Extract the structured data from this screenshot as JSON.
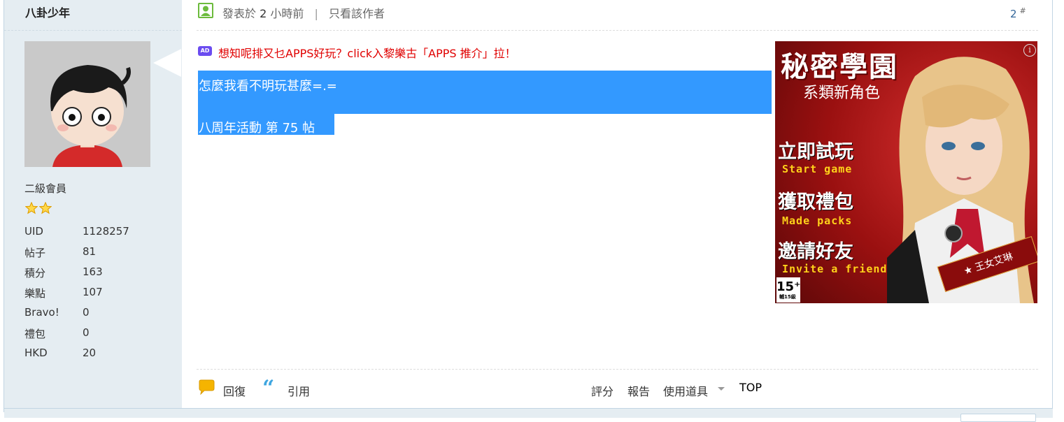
{
  "author": {
    "username": "八卦少年",
    "rank": "二級會員",
    "stars": 2,
    "stats": [
      {
        "key": "UID",
        "value": "1128257"
      },
      {
        "key": "帖子",
        "value": "81"
      },
      {
        "key": "積分",
        "value": "163"
      },
      {
        "key": "樂點",
        "value": "107"
      },
      {
        "key": "Bravo!",
        "value": "0"
      },
      {
        "key": "禮包",
        "value": "0"
      },
      {
        "key": "HKD",
        "value": "20"
      }
    ]
  },
  "post_header": {
    "posted_prefix": "發表於",
    "posted_num": "2",
    "posted_suffix": "小時前",
    "separator": "|",
    "author_only": "只看該作者",
    "floor_number": "2",
    "floor_mark": "#"
  },
  "ad_line": {
    "icon": "AD",
    "text": "想知呢排又乜APPS好玩？click入黎樂古「APPS 推介」拉！"
  },
  "content": {
    "line1": "怎麼我看不明玩甚麼=.=",
    "line2": "八周年活動 第 75 帖"
  },
  "banner": {
    "title": "秘密學園",
    "subtitle": "系類新角色",
    "ctas": [
      {
        "zh": "立即試玩",
        "en": "Start game"
      },
      {
        "zh": "獲取禮包",
        "en": "Made packs"
      },
      {
        "zh": "邀請好友",
        "en": "Invite a friend"
      }
    ],
    "rating": "15⁺",
    "rating_note": "輔15級",
    "character": "★ 王女艾琳",
    "info_icon": "i"
  },
  "footer": {
    "reply": "回復",
    "quote": "引用",
    "rate": "評分",
    "report": "報告",
    "tools": "使用道具",
    "top": "TOP"
  },
  "colors": {
    "sidebar_bg": "#e5edf2",
    "selection": "#3399ff",
    "ad_text": "#e00000",
    "floor_link": "#336699"
  }
}
